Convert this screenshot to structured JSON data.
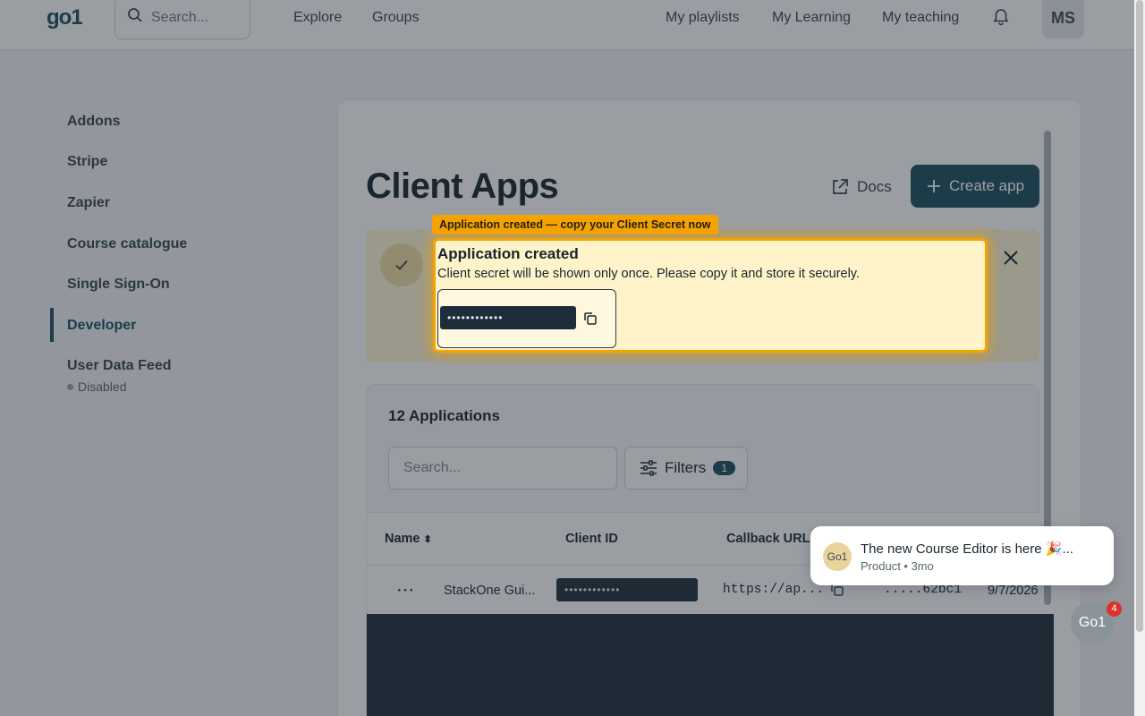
{
  "nav": {
    "logo": "go1",
    "search_placeholder": "Search...",
    "links": [
      "Explore",
      "Groups",
      "My playlists",
      "My Learning",
      "My teaching"
    ],
    "avatar_initials": "MS"
  },
  "sidebar": {
    "items": [
      {
        "label": "Addons"
      },
      {
        "label": "Stripe"
      },
      {
        "label": "Zapier"
      },
      {
        "label": "Course catalogue"
      },
      {
        "label": "Single Sign-On"
      },
      {
        "label": "Developer",
        "active": true
      },
      {
        "label": "User Data Feed",
        "status": "Disabled"
      }
    ]
  },
  "page": {
    "title": "Client Apps",
    "docs_label": "Docs",
    "create_label": "Create app"
  },
  "banner": {
    "callout": "Application created — copy your Client Secret now",
    "title": "Application created",
    "message": "Client secret will be shown only once. Please copy it and store it securely.",
    "secret_masked": "••••••••••••"
  },
  "apps": {
    "count_label": "12 Applications",
    "search_placeholder": "Search...",
    "filters_label": "Filters",
    "filters_count": "1",
    "columns": [
      "Name",
      "Client ID",
      "Callback URL"
    ],
    "rows": [
      {
        "name": "StackOne Gui...",
        "client_id": "••••••••••••",
        "callback_url": "https://ap...",
        "secret": ".....62bc1",
        "date": "9/7/2026"
      }
    ]
  },
  "toast": {
    "avatar": "Go1",
    "title": "The new Course Editor is here 🎉...",
    "meta": "Product • 3mo"
  },
  "chat": {
    "label": "Go1",
    "badge": "4"
  },
  "colors": {
    "brand": "#1c4d5b",
    "highlight": "#f5a300",
    "banner_bg": "#fff6d6"
  }
}
